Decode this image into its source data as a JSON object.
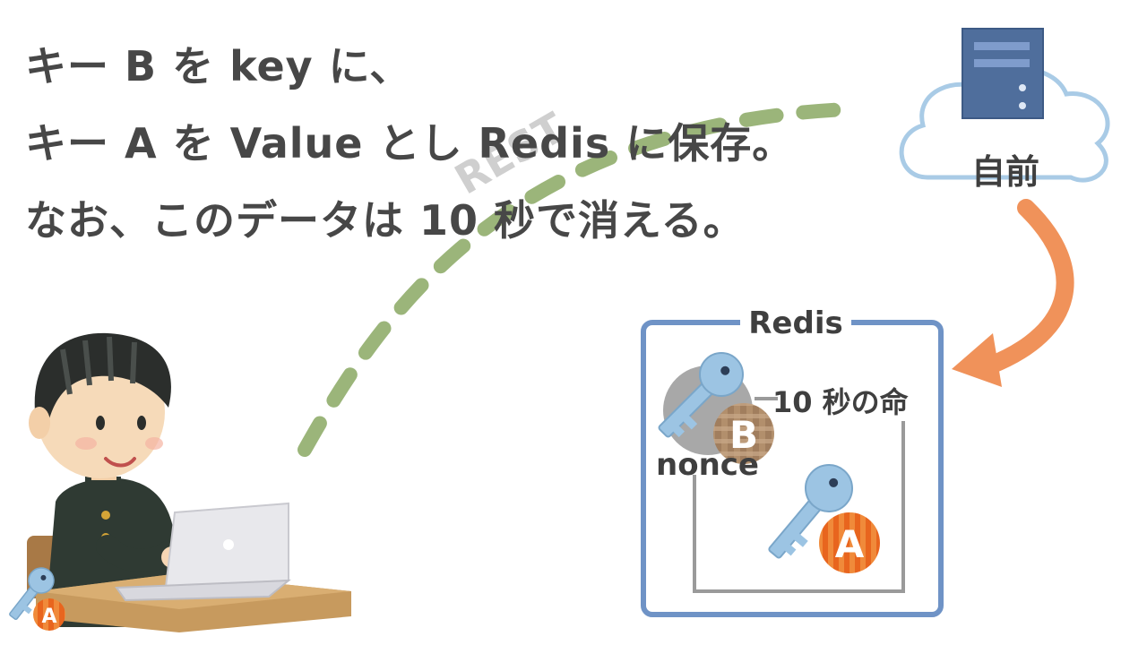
{
  "headline": {
    "line1": "キー B を key に、",
    "line2": "キー A を Value とし Redis に保存。",
    "line3": "なお、このデータは 10 秒で消える。"
  },
  "server": {
    "label": "自前"
  },
  "arrow_label": "REST",
  "redis": {
    "title": "Redis",
    "ttl_label": "10 秒の命",
    "nonce_label": "nonce",
    "key_b_letter": "B",
    "key_a_letter": "A"
  },
  "user": {
    "key_letter": "A"
  },
  "colors": {
    "dashed_path": "#9bb57a",
    "orange_arrow": "#f0925a",
    "redis_border": "#6f93c6",
    "key_blue": "#9cc4e3",
    "badge_orange": "#e8651e",
    "server_blue": "#4f6e9c",
    "cloud_outline": "#a9cbe6"
  }
}
